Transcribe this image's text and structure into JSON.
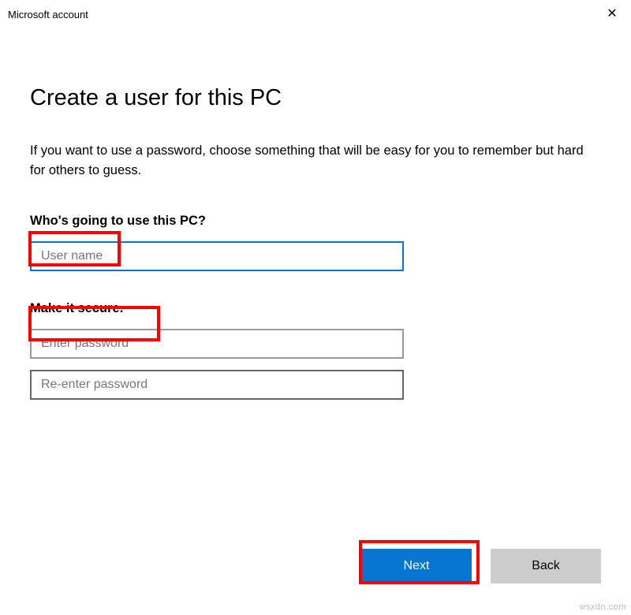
{
  "window": {
    "title": "Microsoft account",
    "close_glyph": "✕"
  },
  "page": {
    "title": "Create a user for this PC",
    "subtitle": "If you want to use a password, choose something that will be easy for you to remember but hard for others to guess."
  },
  "section_user": {
    "label": "Who's going to use this PC?",
    "username_placeholder": "User name",
    "username_value": ""
  },
  "section_secure": {
    "label": "Make it secure.",
    "password_placeholder": "Enter password",
    "password_value": "",
    "repassword_placeholder": "Re-enter password",
    "repassword_value": ""
  },
  "buttons": {
    "next": "Next",
    "back": "Back"
  },
  "watermark": "wsxdn.com"
}
